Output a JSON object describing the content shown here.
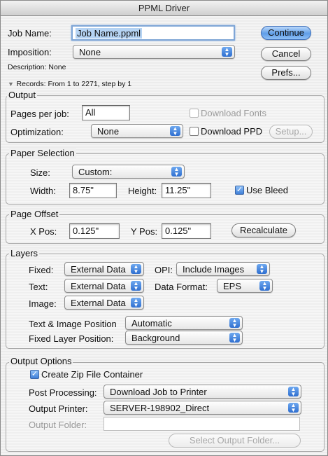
{
  "window": {
    "title": "PPML Driver"
  },
  "job": {
    "job_name_label": "Job Name:",
    "job_name_value": "Job Name.ppml",
    "imposition_label": "Imposition:",
    "imposition_value": "None",
    "description": "Description: None",
    "records_text": "Records:  From 1 to 2271, step by 1"
  },
  "buttons": {
    "continue": "Continue",
    "cancel": "Cancel",
    "prefs": "Prefs...",
    "setup": "Setup...",
    "recalculate": "Recalculate",
    "select_output_folder": "Select Output Folder..."
  },
  "output": {
    "legend": "Output",
    "pages_per_job_label": "Pages per job:",
    "pages_per_job_value": "All",
    "download_fonts_label": "Download Fonts",
    "download_fonts_checked": false,
    "optimization_label": "Optimization:",
    "optimization_value": "None",
    "download_ppd_label": "Download PPD",
    "download_ppd_checked": false
  },
  "paper": {
    "legend": "Paper Selection",
    "size_label": "Size:",
    "size_value": "Custom:",
    "width_label": "Width:",
    "width_value": "8.75\"",
    "height_label": "Height:",
    "height_value": "11.25\"",
    "use_bleed_label": "Use Bleed",
    "use_bleed_checked": true
  },
  "offset": {
    "legend": "Page Offset",
    "xpos_label": "X Pos:",
    "xpos_value": "0.125\"",
    "ypos_label": "Y Pos:",
    "ypos_value": "0.125\""
  },
  "layers": {
    "legend": "Layers",
    "fixed_label": "Fixed:",
    "fixed_value": "External Data",
    "text_label": "Text:",
    "text_value": "External Data",
    "image_label": "Image:",
    "image_value": "External Data",
    "opi_label": "OPI:",
    "opi_value": "Include Images",
    "data_format_label": "Data Format:",
    "data_format_value": "EPS",
    "text_image_position_label": "Text & Image Position",
    "text_image_position_value": "Automatic",
    "fixed_layer_position_label": "Fixed Layer Position:",
    "fixed_layer_position_value": "Background"
  },
  "output_options": {
    "legend": "Output Options",
    "zip_label": "Create Zip File Container",
    "zip_checked": true,
    "post_processing_label": "Post Processing:",
    "post_processing_value": "Download Job to Printer",
    "output_printer_label": "Output Printer:",
    "output_printer_value": "SERVER-198902_Direct",
    "output_folder_label": "Output Folder:",
    "output_folder_value": ""
  },
  "colors": {
    "accent": "#5f9de8",
    "popup_arrow": "#2f6fd0",
    "focus_ring": "#7fa6d6"
  }
}
